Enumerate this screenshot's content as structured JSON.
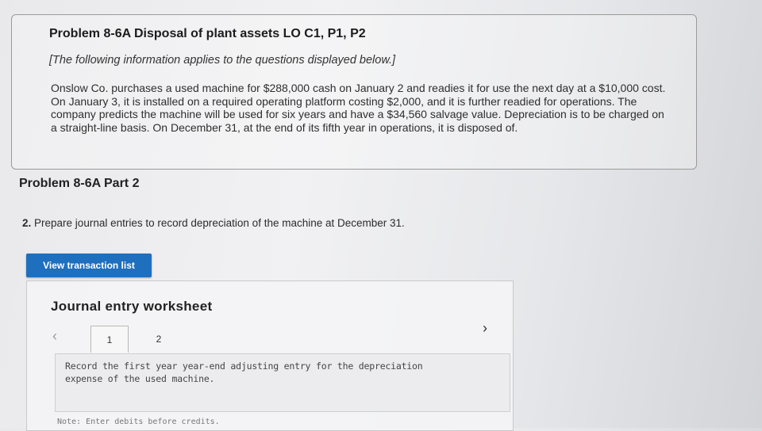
{
  "problem": {
    "title": "Problem 8-6A Disposal of plant assets LO C1, P1, P2",
    "intro_note": "[The following information applies to the questions displayed below.]",
    "text": "Onslow Co. purchases a used machine for $288,000 cash on January 2 and readies it for use the next day at a $10,000 cost. On January 3, it is installed on a required operating platform costing $2,000, and it is further readied for operations. The company predicts the machine will be used for six years and have a $34,560 salvage value. Depreciation is to be charged on a straight-line basis. On December 31, at the end of its fifth year in operations, it is disposed of."
  },
  "part": {
    "title": "Problem 8-6A Part 2",
    "question_number": "2.",
    "question": "Prepare journal entries to record depreciation of the machine at December 31."
  },
  "buttons": {
    "view_transactions": "View transaction list"
  },
  "worksheet": {
    "title": "Journal entry worksheet",
    "prev_icon": "‹",
    "next_icon": "›",
    "tabs": [
      "1",
      "2"
    ],
    "instruction": "Record the first year year-end adjusting entry for the depreciation expense of the used machine.",
    "note": "Note: Enter debits before credits."
  }
}
